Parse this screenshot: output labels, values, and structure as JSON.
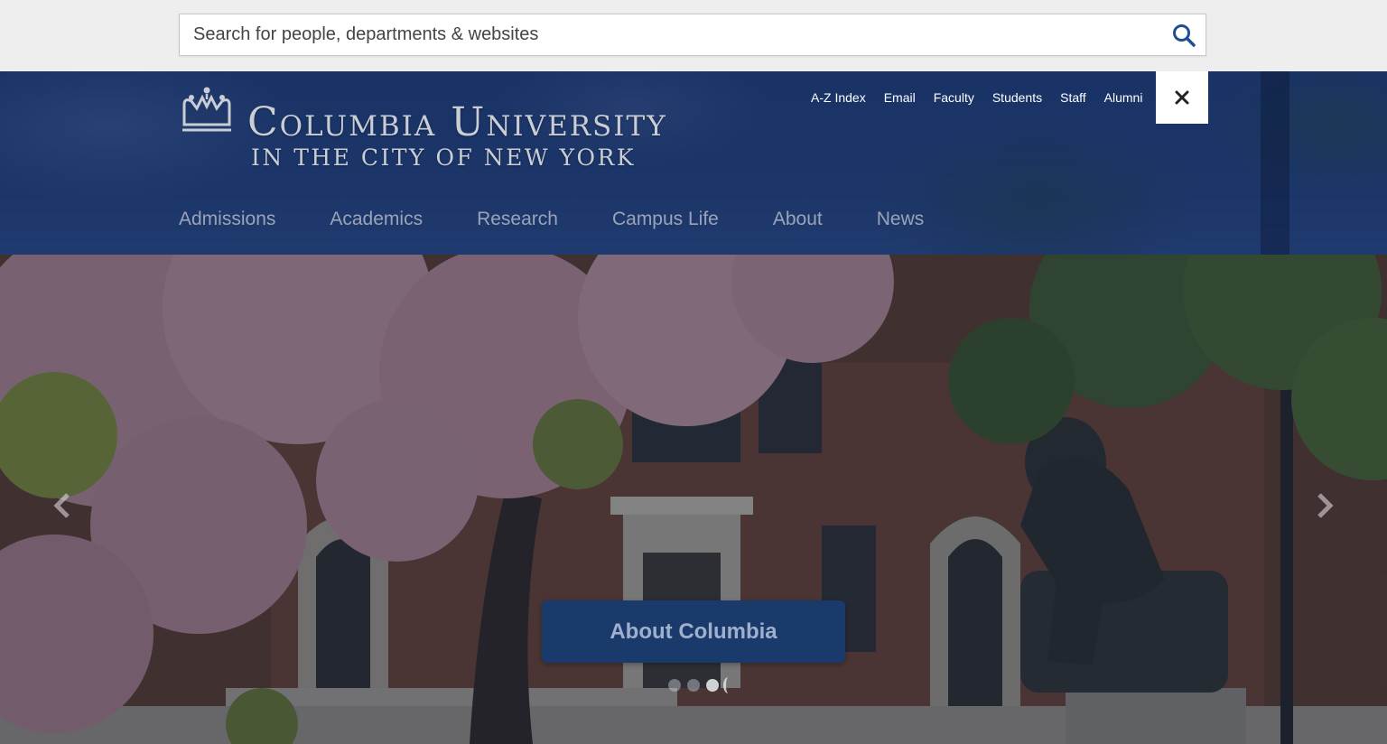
{
  "search": {
    "placeholder": "Search for people, departments & websites",
    "icon": "search-icon"
  },
  "brand": {
    "line1": "Columbia University",
    "line2": "IN THE CITY OF NEW YORK",
    "logo_icon": "crown-icon"
  },
  "utility_nav": [
    {
      "label": "A-Z Index"
    },
    {
      "label": "Email"
    },
    {
      "label": "Faculty"
    },
    {
      "label": "Students"
    },
    {
      "label": "Staff"
    },
    {
      "label": "Alumni"
    }
  ],
  "close": {
    "icon": "close-icon",
    "glyph": "✕"
  },
  "main_nav": [
    {
      "label": "Admissions"
    },
    {
      "label": "Academics"
    },
    {
      "label": "Research"
    },
    {
      "label": "Campus Life"
    },
    {
      "label": "About"
    },
    {
      "label": "News"
    }
  ],
  "hero": {
    "cta_label": "About Columbia",
    "slides_count": 3,
    "active_slide": 3,
    "prev_icon": "chevron-left-icon",
    "next_icon": "chevron-right-icon"
  },
  "colors": {
    "header_blue": "#1f3a6e",
    "cta_blue": "#1a3a6c",
    "nav_text": "#9aa4b8"
  }
}
